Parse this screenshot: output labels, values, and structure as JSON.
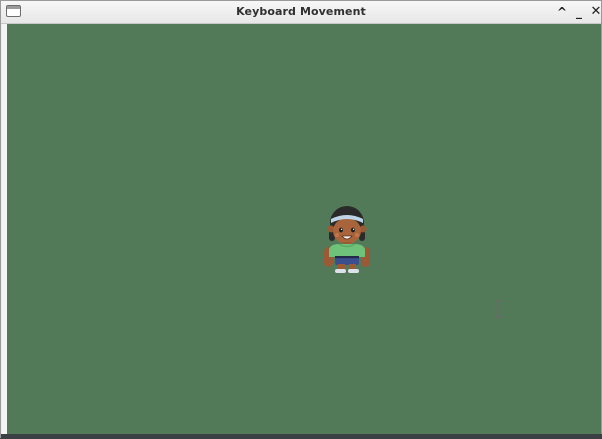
{
  "window": {
    "title": "Keyboard Movement",
    "controls": {
      "maximize": "^",
      "minimize": "_",
      "close": "✕"
    }
  },
  "game": {
    "background_color": "#537a58",
    "player_icon": "girl-character-sprite"
  },
  "cursor": {
    "icon": "text-ibeam-cursor"
  }
}
